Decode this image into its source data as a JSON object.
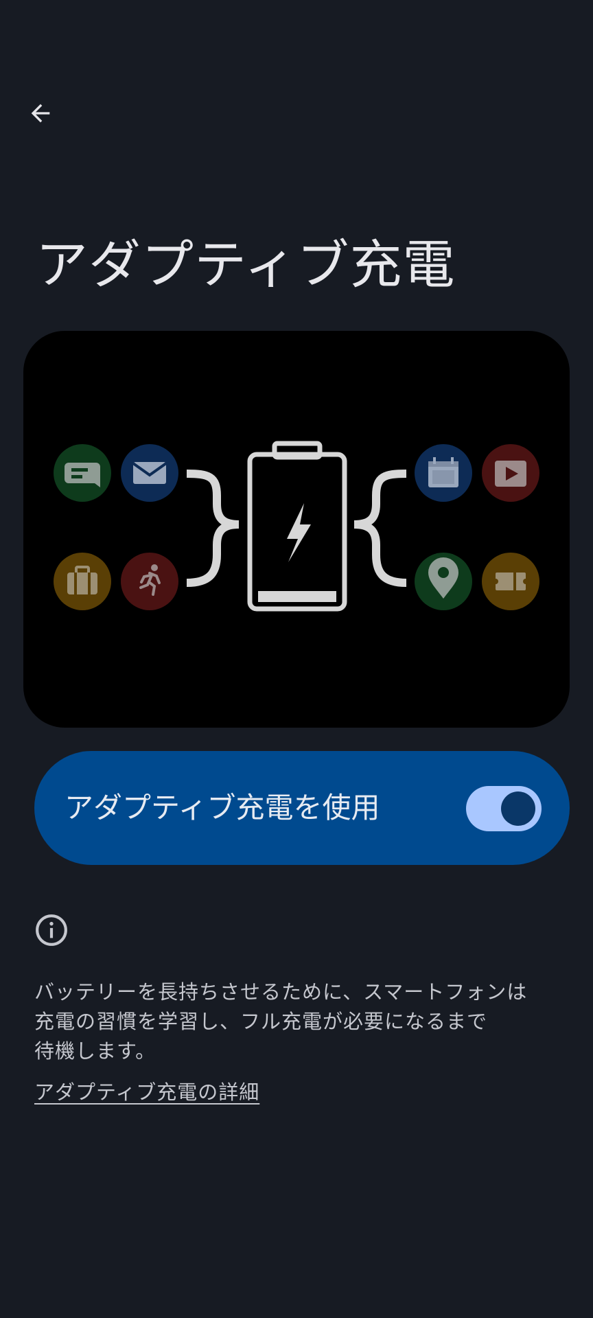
{
  "header": {
    "back_icon": "arrow-back-icon",
    "title": "アダプティブ充電"
  },
  "illustration": {
    "center_icon": "battery-charging-icon",
    "left_icons": [
      "chat-icon",
      "mail-icon",
      "briefcase-icon",
      "running-icon"
    ],
    "right_icons": [
      "calendar-icon",
      "video-icon",
      "map-pin-icon",
      "ticket-icon"
    ],
    "colors": {
      "green": "#0e3b1c",
      "blue": "#0d2b55",
      "yellow": "#5a3f05",
      "red": "#4a1212",
      "glyph": "#d7d7d7"
    }
  },
  "toggle": {
    "label": "アダプティブ充電を使用",
    "state": "on",
    "track_color": "#a9c7ff",
    "knob_color": "#0a3768",
    "card_color": "#004a8f"
  },
  "info": {
    "icon": "info-icon",
    "description": "バッテリーを長持ちさせるために、スマートフォンは\n充電の習慣を学習し、フル充電が必要になるまで\n待機します。",
    "link": "アダプティブ充電の詳細"
  }
}
